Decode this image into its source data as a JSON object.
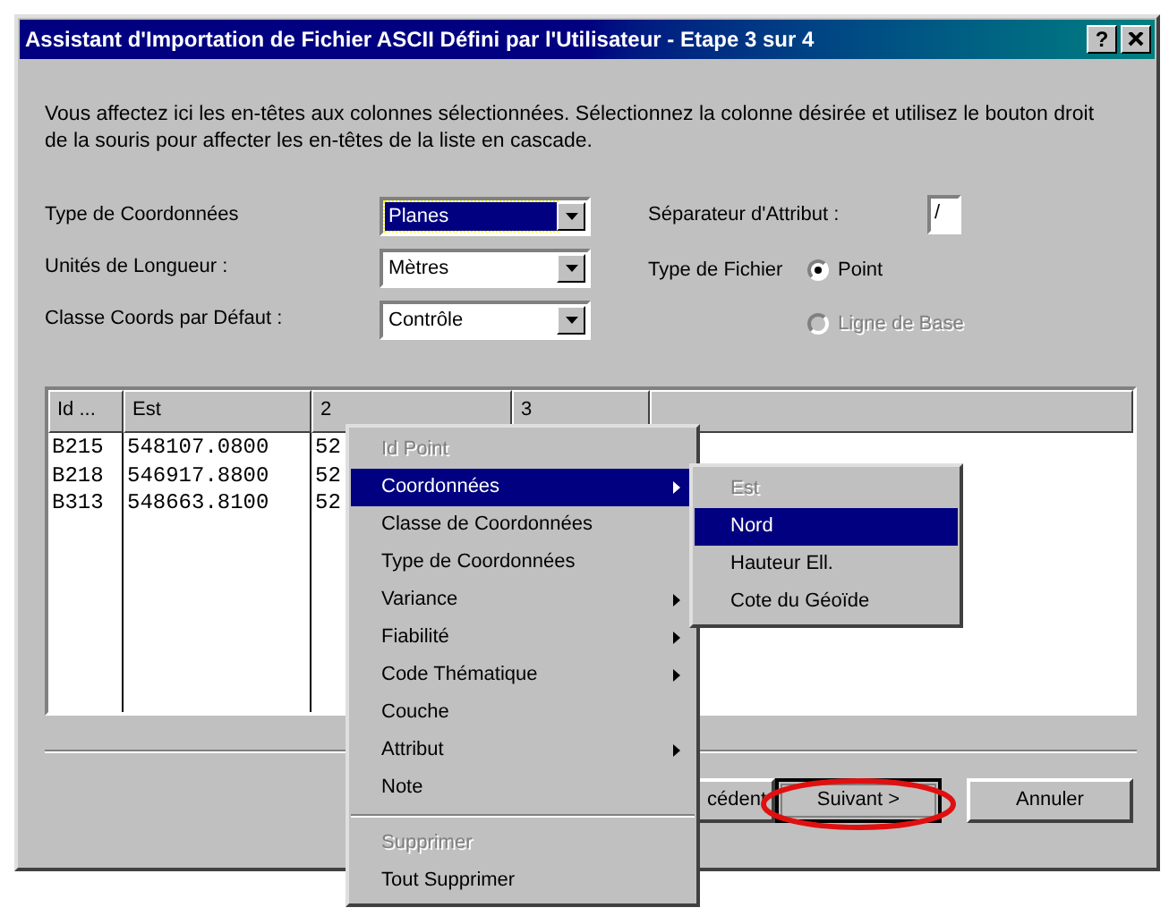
{
  "window": {
    "title": "Assistant d'Importation de Fichier ASCII Défini par l'Utilisateur - Etape 3 sur 4",
    "help_button": "?"
  },
  "instructions": "Vous affectez ici les en-têtes aux colonnes sélectionnées. Sélectionnez la colonne désirée et utilisez le bouton droit de la souris pour affecter les en-têtes de la liste en cascade.",
  "fields": [
    {
      "label": "Type de Coordonnées",
      "value": "Planes",
      "focused": true
    },
    {
      "label": "Unités de Longueur :",
      "value": "Mètres",
      "focused": false
    },
    {
      "label": "Classe Coords par Défaut :",
      "value": "Contrôle",
      "focused": false
    }
  ],
  "separator_field": {
    "label": "Séparateur d'Attribut :",
    "value": "/"
  },
  "file_type": {
    "label": "Type de Fichier",
    "options": [
      {
        "label": "Point",
        "selected": true,
        "disabled": false
      },
      {
        "label": "Ligne de Base",
        "selected": false,
        "disabled": true
      }
    ]
  },
  "table": {
    "columns": [
      "Id ...",
      "Est",
      "2",
      "3"
    ],
    "rows": [
      [
        "B215",
        "548107.0800",
        "52"
      ],
      [
        "B218",
        "546917.8800",
        "52"
      ],
      [
        "B313",
        "548663.8100",
        "52"
      ]
    ]
  },
  "buttons": [
    {
      "label": "cédent",
      "default": false,
      "circled": false
    },
    {
      "label": "Suivant >",
      "default": true,
      "circled": true
    },
    {
      "label": "Annuler",
      "default": false,
      "circled": false
    }
  ],
  "context_menu": {
    "items": [
      {
        "kind": "item",
        "label": "Id Point",
        "disabled": true,
        "selected": false,
        "submenu": false
      },
      {
        "kind": "item",
        "label": "Coordonnées",
        "disabled": false,
        "selected": true,
        "submenu": true
      },
      {
        "kind": "item",
        "label": "Classe de Coordonnées",
        "disabled": false,
        "selected": false,
        "submenu": false
      },
      {
        "kind": "item",
        "label": "Type de Coordonnées",
        "disabled": false,
        "selected": false,
        "submenu": false
      },
      {
        "kind": "item",
        "label": "Variance",
        "disabled": false,
        "selected": false,
        "submenu": true
      },
      {
        "kind": "item",
        "label": "Fiabilité",
        "disabled": false,
        "selected": false,
        "submenu": true
      },
      {
        "kind": "item",
        "label": "Code Thématique",
        "disabled": false,
        "selected": false,
        "submenu": true
      },
      {
        "kind": "item",
        "label": "Couche",
        "disabled": false,
        "selected": false,
        "submenu": false
      },
      {
        "kind": "item",
        "label": "Attribut",
        "disabled": false,
        "selected": false,
        "submenu": true
      },
      {
        "kind": "item",
        "label": "Note",
        "disabled": false,
        "selected": false,
        "submenu": false
      },
      {
        "kind": "separator"
      },
      {
        "kind": "item",
        "label": "Supprimer",
        "disabled": true,
        "selected": false,
        "submenu": false
      },
      {
        "kind": "item",
        "label": "Tout Supprimer",
        "disabled": false,
        "selected": false,
        "submenu": false
      }
    ]
  },
  "submenu": {
    "items": [
      {
        "label": "Est",
        "disabled": true,
        "selected": false
      },
      {
        "label": "Nord",
        "disabled": false,
        "selected": true
      },
      {
        "label": "Hauteur Ell.",
        "disabled": false,
        "selected": false
      },
      {
        "label": "Cote du Géoïde",
        "disabled": false,
        "selected": false
      }
    ]
  }
}
